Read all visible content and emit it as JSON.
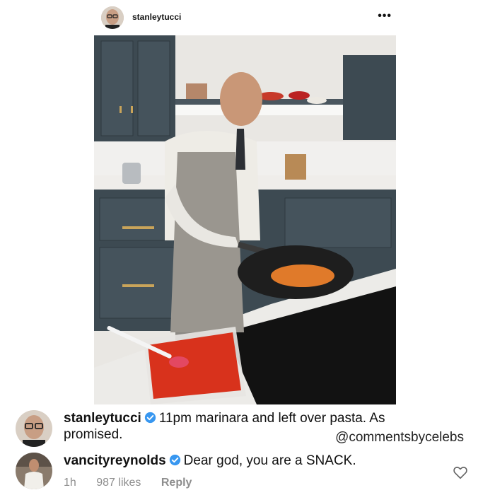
{
  "post": {
    "username": "stanleytucci",
    "more_icon": "more-dots-icon",
    "more_glyph": "•••"
  },
  "comments": [
    {
      "username": "stanleytucci",
      "verified": true,
      "text_line1": "11pm marinara and left over pasta. As",
      "text_line2": "promised."
    },
    {
      "username": "vancityreynolds",
      "verified": true,
      "text": "Dear god, you are a SNACK.",
      "time": "1h",
      "likes": "987 likes",
      "reply_label": "Reply",
      "like_icon": "heart-outline-icon"
    }
  ],
  "watermark": "@commentsbycelebs",
  "colors": {
    "verified_blue": "#3897f0",
    "meta_gray": "#8e8e8e",
    "cabinet": "#3d4a52",
    "sauce": "#d8321c"
  }
}
